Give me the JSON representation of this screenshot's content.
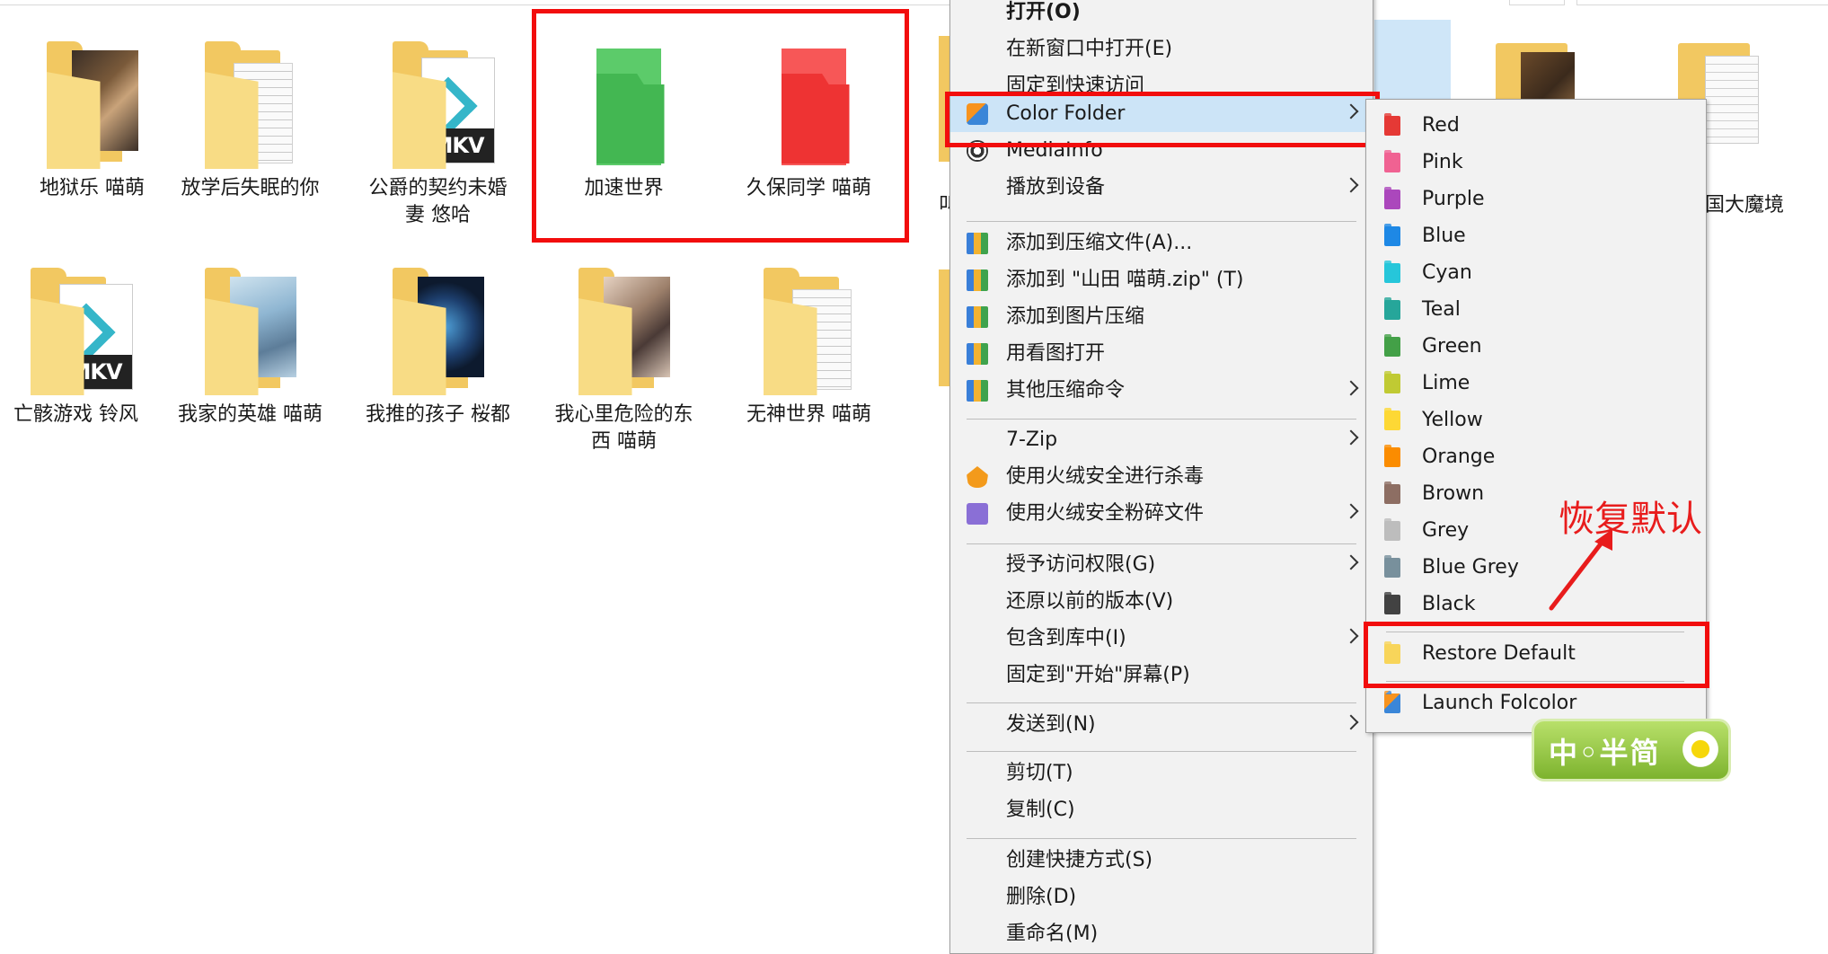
{
  "folders_row1": [
    {
      "name": "地狱乐 喵萌",
      "icon": "folder-thumbnail-icon"
    },
    {
      "name": "放学后失眠的你",
      "icon": "folder-document-icon"
    },
    {
      "name": "公爵的契约未婚妻 悠哈",
      "name_line1": "公爵的契约未婚",
      "name_line2": "妻 悠哈",
      "icon": "folder-mkv-icon"
    },
    {
      "name": "加速世界",
      "icon": "green-folder-icon",
      "color": "#4cbe5a"
    },
    {
      "name": "久保同学 喵萌",
      "icon": "red-folder-icon",
      "color": "#f23c3c"
    }
  ],
  "folders_row2": [
    {
      "name": "亡骸游戏 铃风",
      "icon": "folder-mkv-icon"
    },
    {
      "name": "我家的英雄 喵萌",
      "icon": "folder-thumbnail-icon"
    },
    {
      "name": "我推的孩子 桜都",
      "icon": "folder-thumbnail-icon"
    },
    {
      "name": "我心里危险的东西 喵萌",
      "name_line1": "我心里危险的东",
      "name_line2": "西 喵萌",
      "icon": "folder-thumbnail-icon"
    },
    {
      "name": "无神世界 喵萌",
      "icon": "folder-document-icon"
    }
  ],
  "partial_left_label": "叫",
  "partial_right_label": "国大魔境",
  "context_menu": {
    "items": [
      {
        "label": "打开(O)",
        "bold": true
      },
      {
        "label": "在新窗口中打开(E)"
      },
      {
        "label": "固定到快速访问"
      },
      {
        "label": "Color Folder",
        "icon": "color-folder-icon",
        "submenu": true,
        "highlighted": true
      },
      {
        "label": "MediaInfo",
        "icon": "mediainfo-icon"
      },
      {
        "label": "播放到设备",
        "submenu": true
      },
      {
        "label": "添加到压缩文件(A)...",
        "icon": "zip-icon"
      },
      {
        "label": "添加到 \"山田 喵萌.zip\" (T)",
        "icon": "zip-icon"
      },
      {
        "label": "添加到图片压缩",
        "icon": "zip-icon"
      },
      {
        "label": "用看图打开",
        "icon": "zip-icon"
      },
      {
        "label": "其他压缩命令",
        "icon": "zip-icon",
        "submenu": true
      },
      {
        "label": "7-Zip",
        "submenu": true
      },
      {
        "label": "使用火绒安全进行杀毒",
        "icon": "huorong-icon"
      },
      {
        "label": "使用火绒安全粉碎文件",
        "icon": "shredder-icon",
        "submenu": true
      },
      {
        "label": "授予访问权限(G)",
        "submenu": true
      },
      {
        "label": "还原以前的版本(V)"
      },
      {
        "label": "包含到库中(I)",
        "submenu": true
      },
      {
        "label": "固定到\"开始\"屏幕(P)"
      },
      {
        "label": "发送到(N)",
        "submenu": true
      },
      {
        "label": "剪切(T)"
      },
      {
        "label": "复制(C)"
      },
      {
        "label": "创建快捷方式(S)"
      },
      {
        "label": "删除(D)"
      },
      {
        "label": "重命名(M)"
      }
    ]
  },
  "color_submenu": {
    "colors": [
      {
        "label": "Red",
        "color": "#e53935"
      },
      {
        "label": "Pink",
        "color": "#f06292"
      },
      {
        "label": "Purple",
        "color": "#ab47bc"
      },
      {
        "label": "Blue",
        "color": "#1e88e5"
      },
      {
        "label": "Cyan",
        "color": "#26c6da"
      },
      {
        "label": "Teal",
        "color": "#26a69a"
      },
      {
        "label": "Green",
        "color": "#43a047"
      },
      {
        "label": "Lime",
        "color": "#c0ca33"
      },
      {
        "label": "Yellow",
        "color": "#fdd835"
      },
      {
        "label": "Orange",
        "color": "#fb8c00"
      },
      {
        "label": "Brown",
        "color": "#8d6e63"
      },
      {
        "label": "Grey",
        "color": "#bdbdbd"
      },
      {
        "label": "Blue Grey",
        "color": "#78909c"
      },
      {
        "label": "Black",
        "color": "#424242"
      }
    ],
    "restore_label": "Restore Default",
    "restore_color": "#f8d55a",
    "launch_label": "Launch Folcolor"
  },
  "annotation": {
    "text": "恢复默认",
    "color": "#e81c1c"
  },
  "ime_indicator": {
    "text": "中◦半简"
  }
}
